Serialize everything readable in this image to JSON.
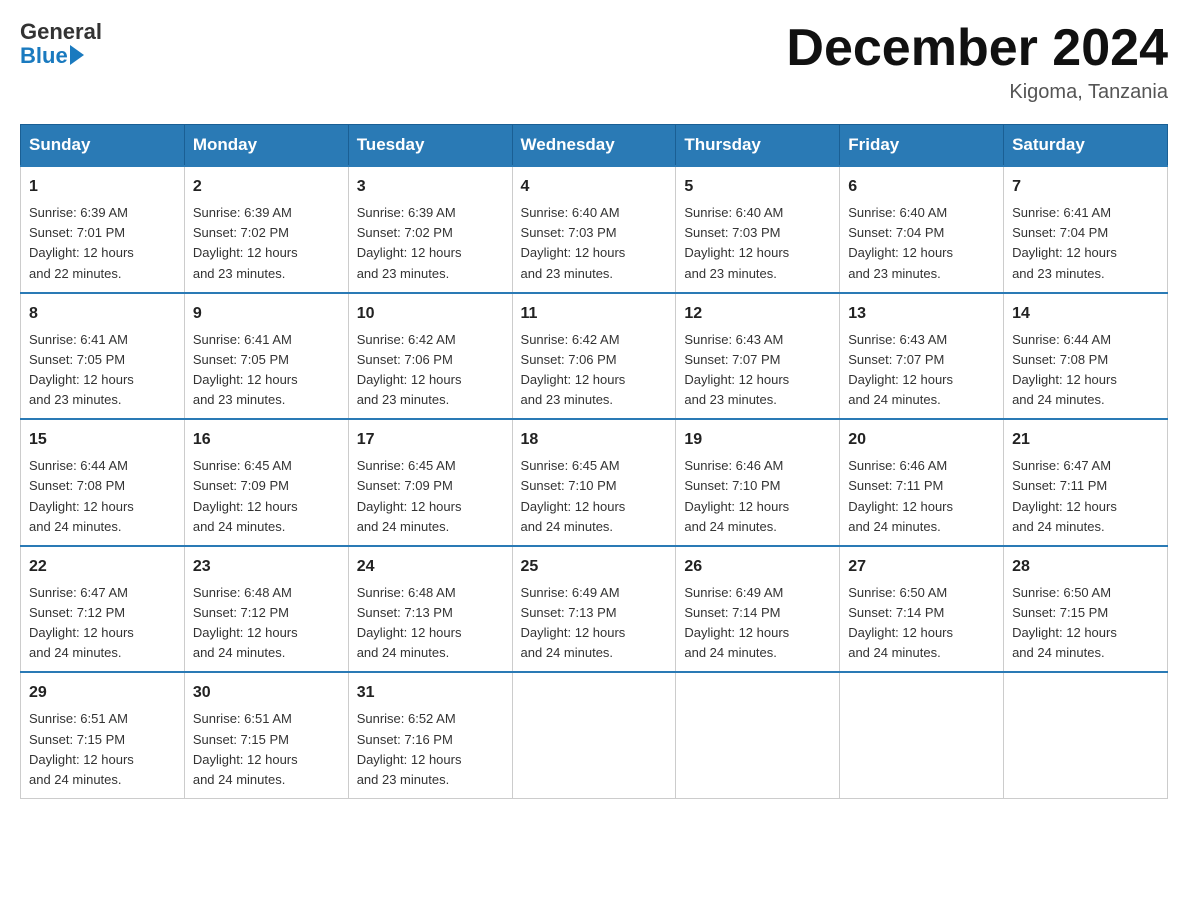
{
  "logo": {
    "text_general": "General",
    "text_blue": "Blue"
  },
  "header": {
    "month_title": "December 2024",
    "location": "Kigoma, Tanzania"
  },
  "weekdays": [
    "Sunday",
    "Monday",
    "Tuesday",
    "Wednesday",
    "Thursday",
    "Friday",
    "Saturday"
  ],
  "weeks": [
    [
      {
        "day": "1",
        "sunrise": "6:39 AM",
        "sunset": "7:01 PM",
        "daylight": "12 hours and 22 minutes."
      },
      {
        "day": "2",
        "sunrise": "6:39 AM",
        "sunset": "7:02 PM",
        "daylight": "12 hours and 23 minutes."
      },
      {
        "day": "3",
        "sunrise": "6:39 AM",
        "sunset": "7:02 PM",
        "daylight": "12 hours and 23 minutes."
      },
      {
        "day": "4",
        "sunrise": "6:40 AM",
        "sunset": "7:03 PM",
        "daylight": "12 hours and 23 minutes."
      },
      {
        "day": "5",
        "sunrise": "6:40 AM",
        "sunset": "7:03 PM",
        "daylight": "12 hours and 23 minutes."
      },
      {
        "day": "6",
        "sunrise": "6:40 AM",
        "sunset": "7:04 PM",
        "daylight": "12 hours and 23 minutes."
      },
      {
        "day": "7",
        "sunrise": "6:41 AM",
        "sunset": "7:04 PM",
        "daylight": "12 hours and 23 minutes."
      }
    ],
    [
      {
        "day": "8",
        "sunrise": "6:41 AM",
        "sunset": "7:05 PM",
        "daylight": "12 hours and 23 minutes."
      },
      {
        "day": "9",
        "sunrise": "6:41 AM",
        "sunset": "7:05 PM",
        "daylight": "12 hours and 23 minutes."
      },
      {
        "day": "10",
        "sunrise": "6:42 AM",
        "sunset": "7:06 PM",
        "daylight": "12 hours and 23 minutes."
      },
      {
        "day": "11",
        "sunrise": "6:42 AM",
        "sunset": "7:06 PM",
        "daylight": "12 hours and 23 minutes."
      },
      {
        "day": "12",
        "sunrise": "6:43 AM",
        "sunset": "7:07 PM",
        "daylight": "12 hours and 23 minutes."
      },
      {
        "day": "13",
        "sunrise": "6:43 AM",
        "sunset": "7:07 PM",
        "daylight": "12 hours and 24 minutes."
      },
      {
        "day": "14",
        "sunrise": "6:44 AM",
        "sunset": "7:08 PM",
        "daylight": "12 hours and 24 minutes."
      }
    ],
    [
      {
        "day": "15",
        "sunrise": "6:44 AM",
        "sunset": "7:08 PM",
        "daylight": "12 hours and 24 minutes."
      },
      {
        "day": "16",
        "sunrise": "6:45 AM",
        "sunset": "7:09 PM",
        "daylight": "12 hours and 24 minutes."
      },
      {
        "day": "17",
        "sunrise": "6:45 AM",
        "sunset": "7:09 PM",
        "daylight": "12 hours and 24 minutes."
      },
      {
        "day": "18",
        "sunrise": "6:45 AM",
        "sunset": "7:10 PM",
        "daylight": "12 hours and 24 minutes."
      },
      {
        "day": "19",
        "sunrise": "6:46 AM",
        "sunset": "7:10 PM",
        "daylight": "12 hours and 24 minutes."
      },
      {
        "day": "20",
        "sunrise": "6:46 AM",
        "sunset": "7:11 PM",
        "daylight": "12 hours and 24 minutes."
      },
      {
        "day": "21",
        "sunrise": "6:47 AM",
        "sunset": "7:11 PM",
        "daylight": "12 hours and 24 minutes."
      }
    ],
    [
      {
        "day": "22",
        "sunrise": "6:47 AM",
        "sunset": "7:12 PM",
        "daylight": "12 hours and 24 minutes."
      },
      {
        "day": "23",
        "sunrise": "6:48 AM",
        "sunset": "7:12 PM",
        "daylight": "12 hours and 24 minutes."
      },
      {
        "day": "24",
        "sunrise": "6:48 AM",
        "sunset": "7:13 PM",
        "daylight": "12 hours and 24 minutes."
      },
      {
        "day": "25",
        "sunrise": "6:49 AM",
        "sunset": "7:13 PM",
        "daylight": "12 hours and 24 minutes."
      },
      {
        "day": "26",
        "sunrise": "6:49 AM",
        "sunset": "7:14 PM",
        "daylight": "12 hours and 24 minutes."
      },
      {
        "day": "27",
        "sunrise": "6:50 AM",
        "sunset": "7:14 PM",
        "daylight": "12 hours and 24 minutes."
      },
      {
        "day": "28",
        "sunrise": "6:50 AM",
        "sunset": "7:15 PM",
        "daylight": "12 hours and 24 minutes."
      }
    ],
    [
      {
        "day": "29",
        "sunrise": "6:51 AM",
        "sunset": "7:15 PM",
        "daylight": "12 hours and 24 minutes."
      },
      {
        "day": "30",
        "sunrise": "6:51 AM",
        "sunset": "7:15 PM",
        "daylight": "12 hours and 24 minutes."
      },
      {
        "day": "31",
        "sunrise": "6:52 AM",
        "sunset": "7:16 PM",
        "daylight": "12 hours and 23 minutes."
      },
      null,
      null,
      null,
      null
    ]
  ],
  "labels": {
    "sunrise_prefix": "Sunrise: ",
    "sunset_prefix": "Sunset: ",
    "daylight_prefix": "Daylight: "
  }
}
